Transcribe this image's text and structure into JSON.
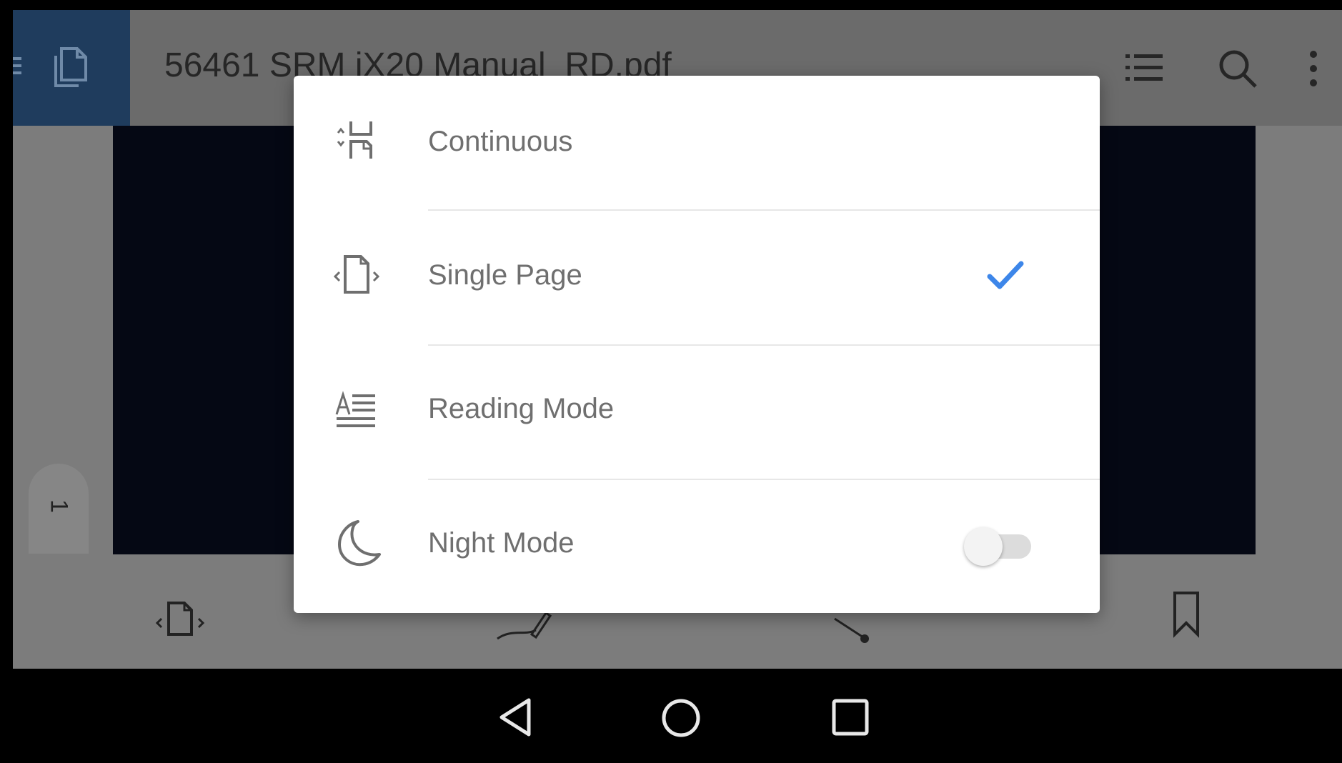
{
  "app_bar": {
    "title": "56461 SRM iX20 Manual_RD.pdf",
    "icons": [
      "menu-icon",
      "document-icon",
      "list-icon",
      "search-icon",
      "more-vert-icon"
    ],
    "accent_color": "#1f3c5d"
  },
  "page_indicator": {
    "page": "1"
  },
  "view_menu": {
    "items": [
      {
        "label": "Continuous",
        "icon": "continuous-scroll-icon"
      },
      {
        "label": "Single Page",
        "icon": "single-page-icon",
        "selected": true
      },
      {
        "label": "Reading Mode",
        "icon": "reading-mode-icon"
      },
      {
        "label": "Night Mode",
        "icon": "moon-icon",
        "toggle": false
      }
    ],
    "check_color": "#3d86e9"
  },
  "bottom_toolbar": {
    "icons": [
      "single-page-icon",
      "annotate-pen-icon",
      "share-icon",
      "bookmark-icon"
    ]
  },
  "navigation_bar": {
    "icons": [
      "back-triangle-icon",
      "home-circle-icon",
      "recents-square-icon"
    ]
  }
}
